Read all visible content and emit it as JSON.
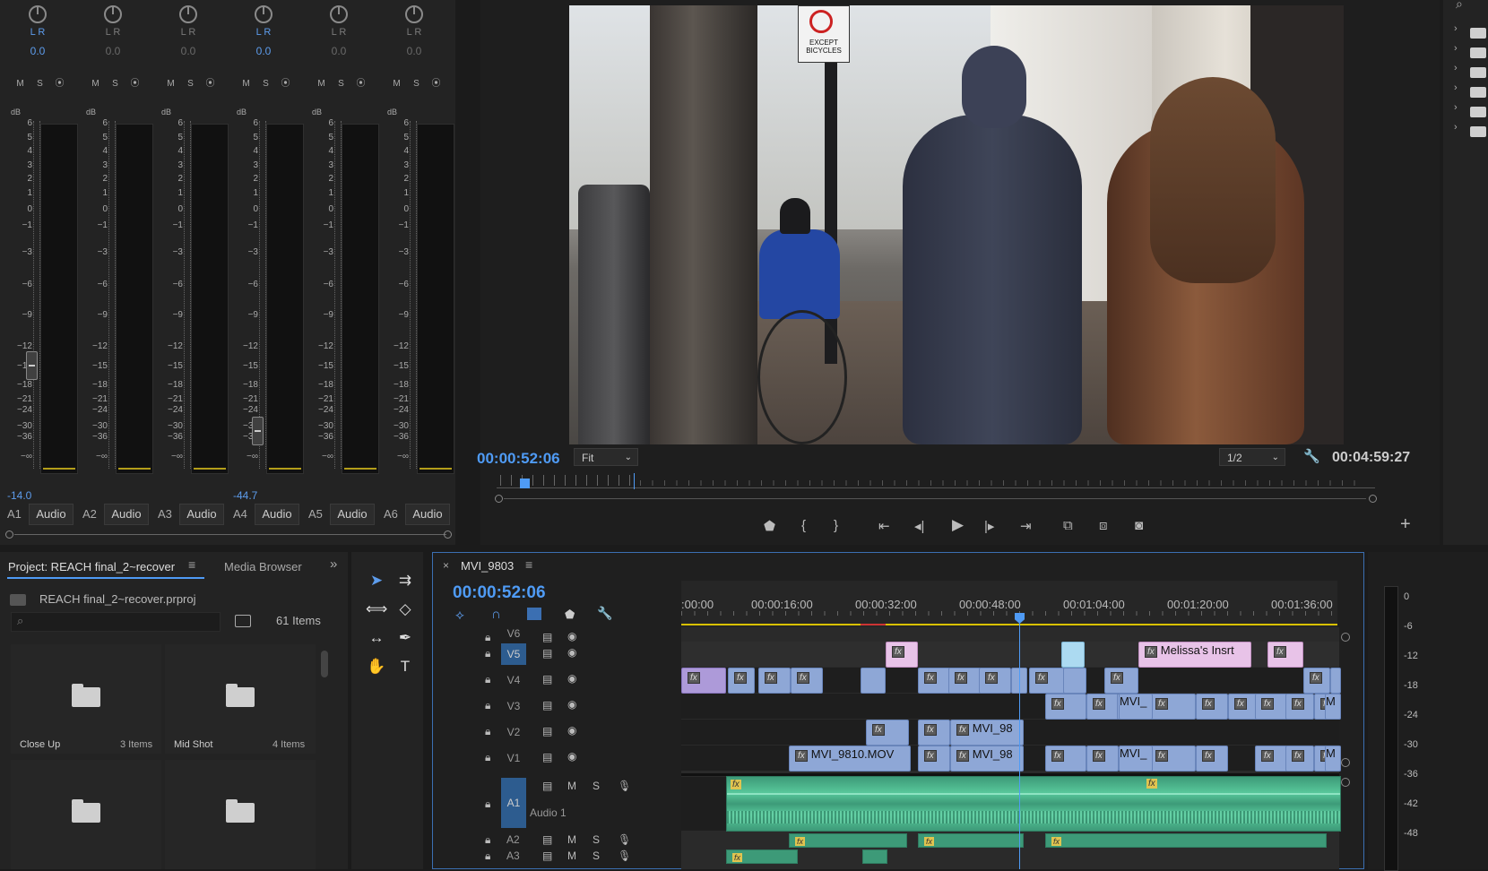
{
  "mixer": {
    "channels": [
      {
        "id": "A1",
        "lr": "L R",
        "pan": "0.0",
        "active": true,
        "volume": "-14.0",
        "button": "Audio",
        "fader_db": -13
      },
      {
        "id": "A2",
        "lr": "L R",
        "pan": "0.0",
        "active": false,
        "volume": "",
        "button": "Audio",
        "fader_db": null
      },
      {
        "id": "A3",
        "lr": "L R",
        "pan": "0.0",
        "active": false,
        "volume": "",
        "button": "Audio",
        "fader_db": null
      },
      {
        "id": "A4",
        "lr": "L R",
        "pan": "0.0",
        "active": true,
        "volume": "-44.7",
        "button": "Audio",
        "fader_db": -42
      },
      {
        "id": "A5",
        "lr": "L R",
        "pan": "0.0",
        "active": false,
        "volume": "",
        "button": "Audio",
        "fader_db": null
      },
      {
        "id": "A6",
        "lr": "L R",
        "pan": "0.0",
        "active": false,
        "volume": "",
        "button": "Audio",
        "fader_db": null
      }
    ],
    "ms_labels": [
      "M",
      "S",
      "⦿"
    ],
    "db_unit": "dB",
    "scale": [
      "6",
      "5",
      "4",
      "3",
      "2",
      "1",
      "0",
      "−1",
      "−3",
      "−6",
      "−9",
      "−12",
      "−15",
      "−18",
      "−21",
      "−24",
      "−30",
      "−36",
      "−∞"
    ]
  },
  "monitor": {
    "timecode": "00:00:52:06",
    "fit": "Fit",
    "resolution": "1/2",
    "duration": "00:04:59:27",
    "sign_text": "EXCEPT BICYCLES"
  },
  "project": {
    "tab_project": "Project: REACH final_2~recover",
    "tab_media": "Media Browser",
    "filename": "REACH final_2~recover.prproj",
    "items_count": "61 Items",
    "bins": [
      {
        "label": "Close Up",
        "count": "3 Items"
      },
      {
        "label": "Mid Shot",
        "count": "4 Items"
      },
      {
        "label": "",
        "count": ""
      },
      {
        "label": "",
        "count": ""
      }
    ]
  },
  "timeline": {
    "sequence_name": "MVI_9803",
    "timecode": "00:00:52:06",
    "ruler": [
      ":00:00",
      "00:00:16:00",
      "00:00:32:00",
      "00:00:48:00",
      "00:01:04:00",
      "00:01:20:00",
      "00:01:36:00"
    ],
    "tracks": {
      "v6": "V6",
      "v5": "V5",
      "v4": "V4",
      "v3": "V3",
      "v2": "V2",
      "v1": "V1",
      "a1": "A1",
      "a1_name": "Audio 1",
      "a2": "A2",
      "a3": "A3"
    },
    "clip_labels": {
      "melissa": "Melissa's Insrt",
      "mvi_9810": "MVI_9810.MOV",
      "mvi_98_v2": "MVI_98",
      "mvi_98_v1": "MVI_98",
      "mvi_v3": "MVI_",
      "mvi_v1": "MVI_",
      "m_v3": "M",
      "m_v1": "M",
      "fx": "fx"
    },
    "audio_track_buttons": [
      "M",
      "S"
    ],
    "meter_scale": [
      "0",
      "-6",
      "-12",
      "-18",
      "-24",
      "-30",
      "-36",
      "-42",
      "-48"
    ]
  },
  "colors": {
    "accent_blue": "#4f9bf5",
    "clip_blue": "#8ea7d6",
    "clip_purple": "#ad9ad9",
    "clip_pink": "#e8c3e8",
    "audio_green": "#3d9a78",
    "playhead": "#4f9bf5"
  }
}
